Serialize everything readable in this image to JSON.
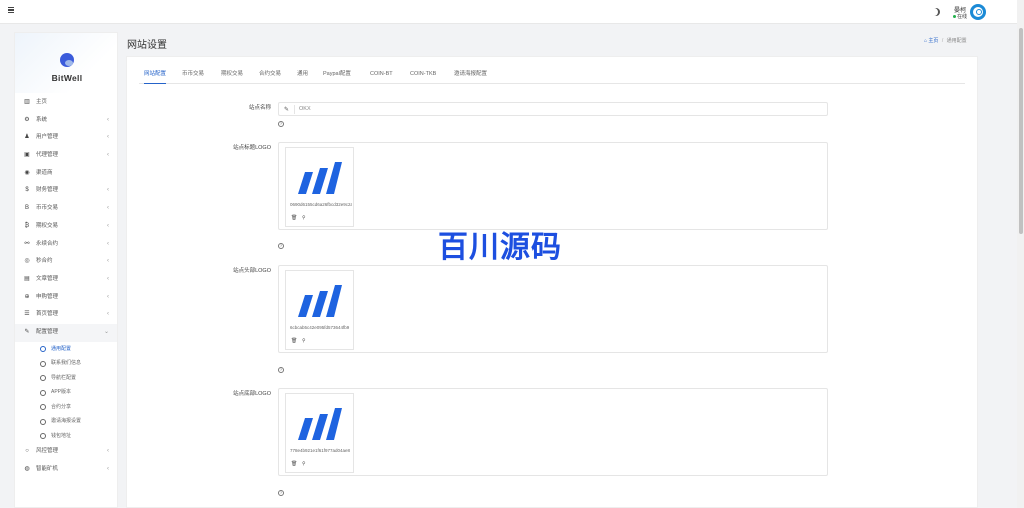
{
  "topbar": {
    "user_name": "晏柯",
    "user_status": "在线"
  },
  "brand": {
    "name": "BitWell"
  },
  "sidebar": {
    "items": [
      {
        "label": "主页",
        "icon": "chart-icon",
        "glyph": "▥",
        "chevron": ""
      },
      {
        "label": "系统",
        "icon": "gear-icon",
        "glyph": "⚙",
        "chevron": "‹"
      },
      {
        "label": "用户管理",
        "icon": "user-icon",
        "glyph": "♟",
        "chevron": "‹"
      },
      {
        "label": "代理管理",
        "icon": "id-card-icon",
        "glyph": "▣",
        "chevron": "‹"
      },
      {
        "label": "渠道商",
        "icon": "user-circle-icon",
        "glyph": "◉",
        "chevron": ""
      },
      {
        "label": "财务管理",
        "icon": "dollar-icon",
        "glyph": "$",
        "chevron": "‹"
      },
      {
        "label": "币币交易",
        "icon": "bitcoin-icon",
        "glyph": "B",
        "chevron": "‹"
      },
      {
        "label": "期权交易",
        "icon": "bitcoin-circle-icon",
        "glyph": "₿",
        "chevron": "‹"
      },
      {
        "label": "永续合约",
        "icon": "link-icon",
        "glyph": "⚯",
        "chevron": "‹"
      },
      {
        "label": "秒合约",
        "icon": "target-icon",
        "glyph": "◎",
        "chevron": "‹"
      },
      {
        "label": "文章管理",
        "icon": "keyboard-icon",
        "glyph": "▤",
        "chevron": "‹"
      },
      {
        "label": "申购管理",
        "icon": "crosshair-icon",
        "glyph": "⊕",
        "chevron": "‹"
      },
      {
        "label": "首页管理",
        "icon": "list-icon",
        "glyph": "☰",
        "chevron": "‹"
      },
      {
        "label": "配置管理",
        "icon": "wrench-icon",
        "glyph": "✎",
        "chevron": "⌄"
      }
    ],
    "config_submenu": [
      "通用配置",
      "联系我们信息",
      "导航栏配置",
      "APP版本",
      "合约分享",
      "邀请海报设置",
      "钱包地址"
    ],
    "items_after": [
      {
        "label": "风控管理",
        "icon": "circle-icon",
        "glyph": "○",
        "chevron": "‹"
      },
      {
        "label": "智能矿机",
        "icon": "globe-icon",
        "glyph": "◍",
        "chevron": "‹"
      }
    ]
  },
  "header": {
    "title": "网站设置",
    "breadcrumb_home": "主页",
    "breadcrumb_current": "通用配置"
  },
  "tabs": [
    "网站配置",
    "币币交易",
    "期权交易",
    "合约交易",
    "通用",
    "Paypal配置",
    "COIN-BT",
    "COIN-TKB",
    "邀请海报配置"
  ],
  "form": {
    "site_name_label": "站点名称",
    "site_name_value": "OKX",
    "title_logo_label": "站点标题LOGO",
    "title_logo_file": "0690d6155cd6a26fbcd32e9c2a",
    "header_logo_label": "站点头部LOGO",
    "header_logo_file": "6cbcab5c42e095fd573644fb9",
    "footer_logo_label": "站点底部LOGO",
    "footer_logo_file": "778e4b921e1f61f977ad04ae8"
  },
  "watermark": "百川源码",
  "colors": {
    "accent": "#2563c9",
    "logo_blue": "#1e63e0"
  }
}
